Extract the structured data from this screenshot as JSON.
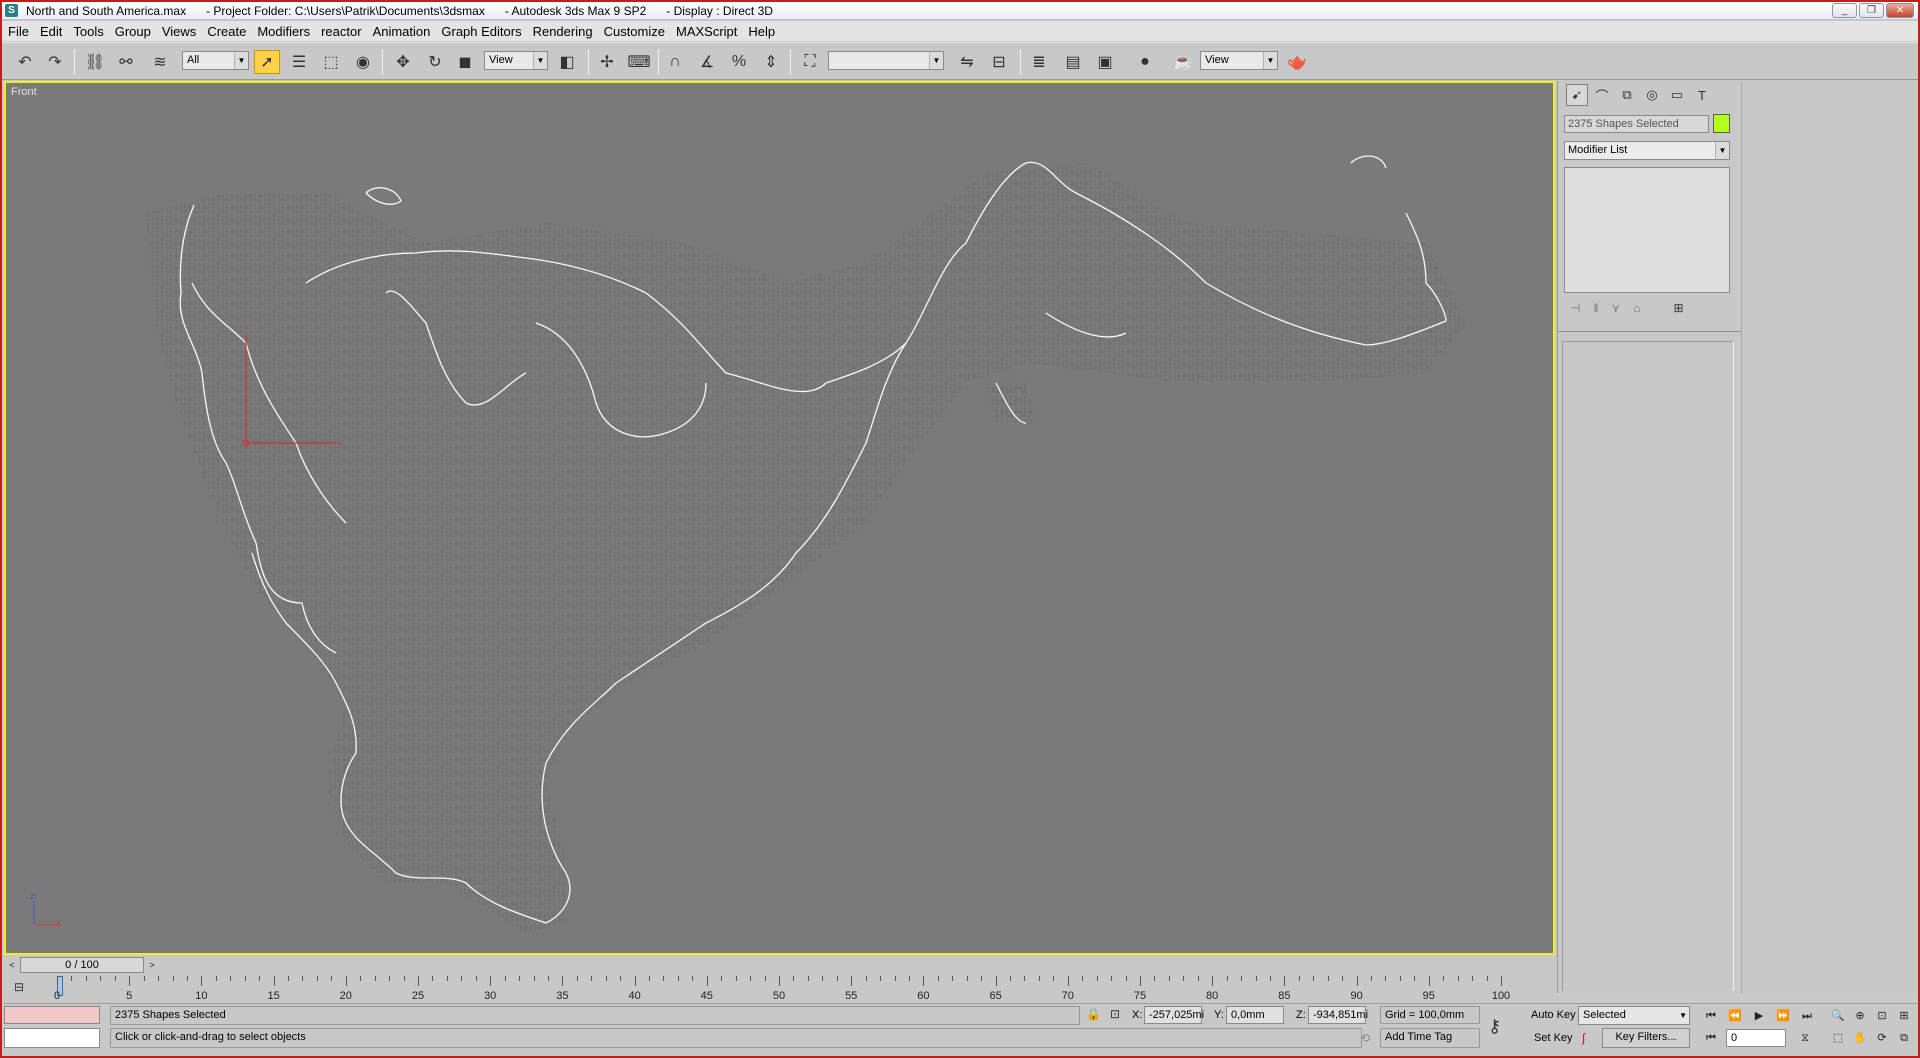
{
  "window": {
    "title": "North and South America.max      - Project Folder: C:\\Users\\Patrik\\Documents\\3dsmax      - Autodesk 3ds Max 9 SP2      - Display : Direct 3D",
    "app_icon": "S",
    "controls": {
      "minimize": "_",
      "restore": "❐",
      "close": "✕"
    }
  },
  "menu": [
    "File",
    "Edit",
    "Tools",
    "Group",
    "Views",
    "Create",
    "Modifiers",
    "reactor",
    "Animation",
    "Graph Editors",
    "Rendering",
    "Customize",
    "MAXScript",
    "Help"
  ],
  "toolbar": {
    "selection_filter": "All",
    "ref_coord_system": "View",
    "named_selection_set": "",
    "render_view": "View"
  },
  "viewport": {
    "label": "Front",
    "axis_z": "z",
    "axis_x": "x",
    "border_color": "#f3ee23",
    "background": "#7a7a7a"
  },
  "command_panel": {
    "tabs": [
      "create-icon",
      "modify-icon",
      "hierarchy-icon",
      "motion-icon",
      "display-icon",
      "utilities-icon"
    ],
    "selection_name": "2375 Shapes Selected",
    "selection_color": "#b3ff1a",
    "modifier_list": "Modifier List"
  },
  "time_slider": {
    "position": "0 / 100",
    "left": "<",
    "right": ">"
  },
  "track_bar": {
    "ticks": [
      "0",
      "5",
      "10",
      "15",
      "20",
      "25",
      "30",
      "35",
      "40",
      "45",
      "50",
      "55",
      "60",
      "65",
      "70",
      "75",
      "80",
      "85",
      "90",
      "95",
      "100"
    ]
  },
  "status": {
    "selection_info": "2375 Shapes Selected",
    "prompt": "Click or click-and-drag to select objects",
    "x_label": "X:",
    "x_value": "-257,025mi",
    "y_label": "Y:",
    "y_value": "0,0mm",
    "z_label": "Z:",
    "z_value": "-934,851mi",
    "grid": "Grid = 100,0mm",
    "add_time_tag": "Add Time Tag",
    "auto_key": "Auto Key",
    "set_key": "Set Key",
    "key_mode": "Selected",
    "key_filters": "Key Filters...",
    "current_frame": "0"
  }
}
